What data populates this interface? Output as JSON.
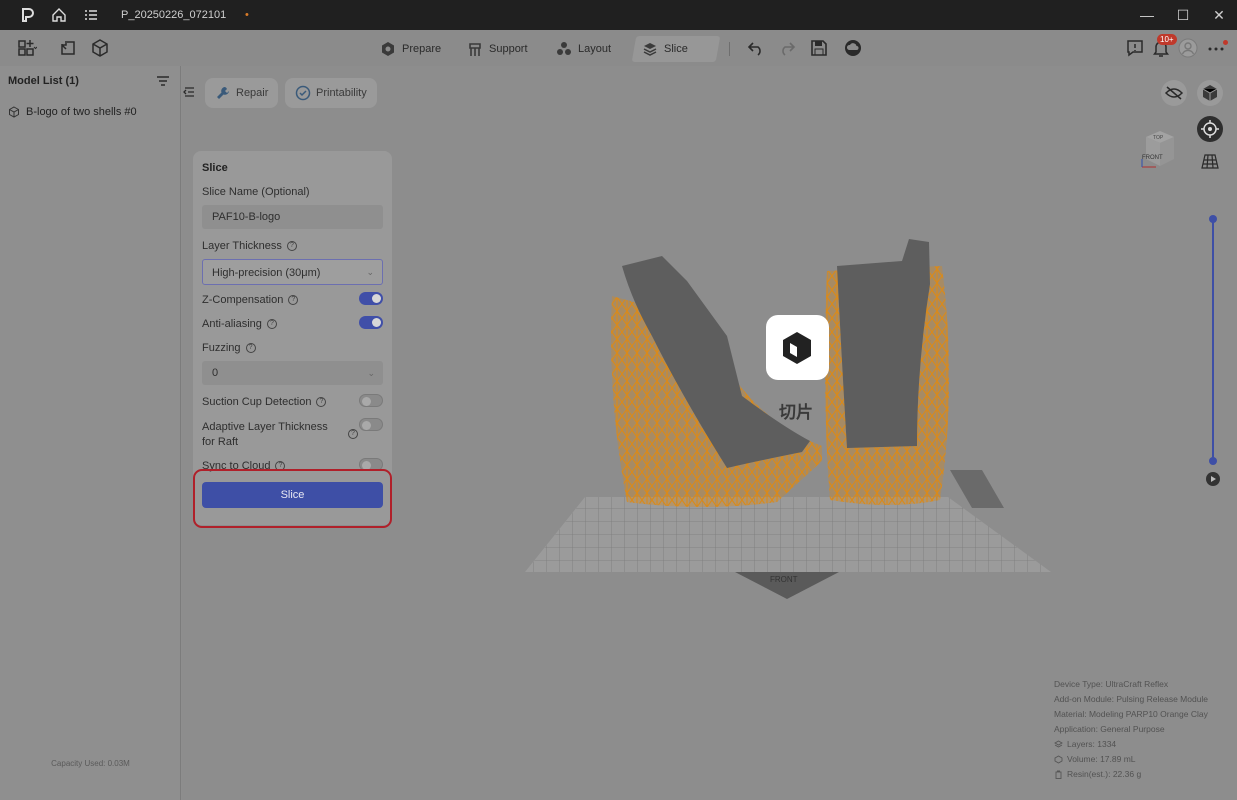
{
  "titlebar": {
    "project_name": "P_20250226_072101",
    "unsaved_dot": "•",
    "icons": [
      "logo-icon",
      "home-icon",
      "menu-list-icon"
    ],
    "window_controls": [
      "minimize-icon",
      "maximize-icon",
      "close-icon"
    ]
  },
  "toolbar": {
    "tabs": [
      {
        "label": "Prepare",
        "icon": "prepare-icon"
      },
      {
        "label": "Support",
        "icon": "support-icon"
      },
      {
        "label": "Layout",
        "icon": "layout-icon"
      },
      {
        "label": "Slice",
        "icon": "slice-icon",
        "active": true
      }
    ],
    "notifications_badge": "10+"
  },
  "left_panel": {
    "title": "Model List (1)",
    "items": [
      {
        "label": "B-logo of two shells #0"
      }
    ],
    "capacity": "Capacity Used: 0.03M"
  },
  "viewport": {
    "buttons": {
      "repair": "Repair",
      "printability": "Printability"
    },
    "loading_text": "切片",
    "platform_label": "FRONT",
    "cube_labels": {
      "top": "TOP",
      "front": "FRONT"
    },
    "slider_position": 1.0
  },
  "slice_panel": {
    "title": "Slice",
    "slice_name_label": "Slice Name (Optional)",
    "slice_name_value": "PAF10-B-logo",
    "layer_thickness_label": "Layer Thickness",
    "layer_thickness_value": "High-precision (30μm)",
    "z_comp_label": "Z-Compensation",
    "z_comp_on": true,
    "anti_alias_label": "Anti-aliasing",
    "anti_alias_on": true,
    "fuzzing_label": "Fuzzing",
    "fuzzing_value": "0",
    "suction_label": "Suction Cup Detection",
    "suction_on": false,
    "adaptive_label": "Adaptive Layer Thickness for Raft",
    "adaptive_on": false,
    "sync_label": "Sync to Cloud",
    "sync_on": false,
    "slice_button": "Slice"
  },
  "info": {
    "device_type": "Device Type:  UltraCraft Reflex",
    "addon_module": "Add-on Module:  Pulsing Release Module",
    "material": "Material:  Modeling PARP10 Orange Clay",
    "application": "Application:  General Purpose",
    "layers": "Layers: 1334",
    "volume": "Volume: 17.89 mL",
    "resin": "Resin(est.): 22.36 g"
  },
  "colors": {
    "accent": "#3e4fa6",
    "support_orange": "#d98a1a",
    "model_gray": "#5e5e5e",
    "highlight_red": "#b0202a"
  }
}
